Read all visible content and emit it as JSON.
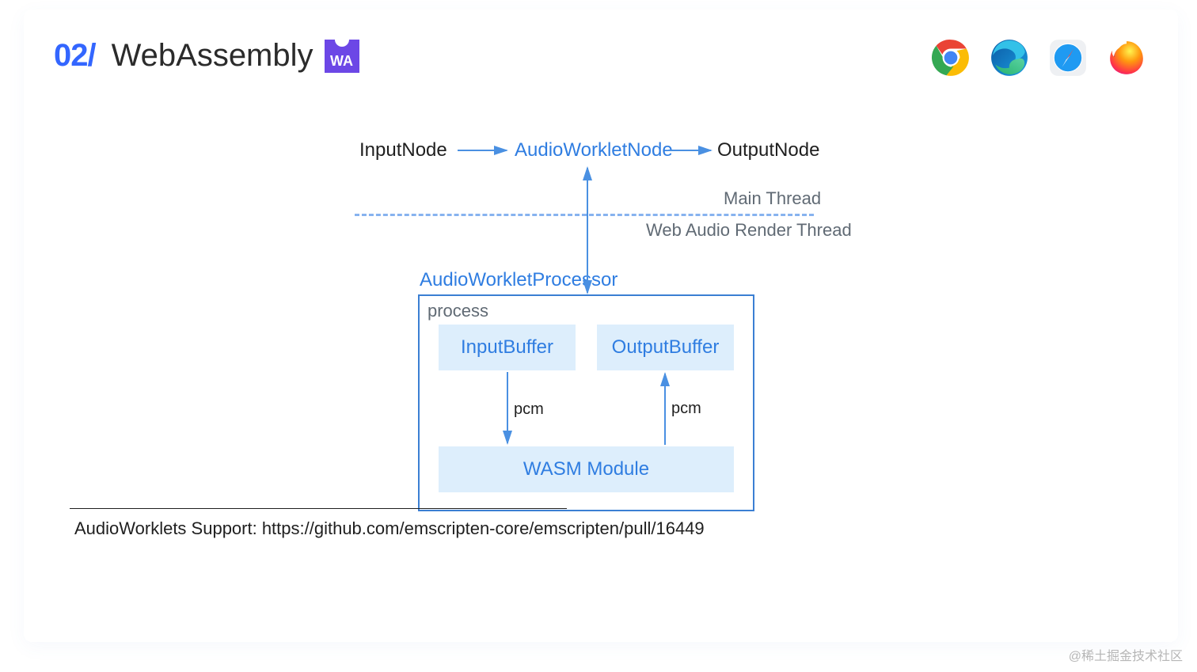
{
  "header": {
    "index": "02/",
    "title": "WebAssembly",
    "wa_label": "WA"
  },
  "browsers": [
    "chrome",
    "edge",
    "safari",
    "firefox"
  ],
  "diagram": {
    "input_node": "InputNode",
    "worklet_node": "AudioWorkletNode",
    "output_node": "OutputNode",
    "main_thread": "Main Thread",
    "render_thread": "Web Audio Render Thread",
    "processor": "AudioWorkletProcessor",
    "process_label": "process",
    "input_buffer": "InputBuffer",
    "output_buffer": "OutputBuffer",
    "pcm_left": "pcm",
    "pcm_right": "pcm",
    "wasm_module": "WASM Module"
  },
  "footnote": "AudioWorklets Support: https://github.com/emscripten-core/emscripten/pull/16449",
  "watermark": "@稀土掘金技术社区",
  "colors": {
    "accent_blue": "#2f7de1",
    "index_blue": "#3366ff",
    "border_blue": "#3b7fd3",
    "fill_blue": "#ddeefc",
    "wa_purple": "#6c47e6"
  }
}
